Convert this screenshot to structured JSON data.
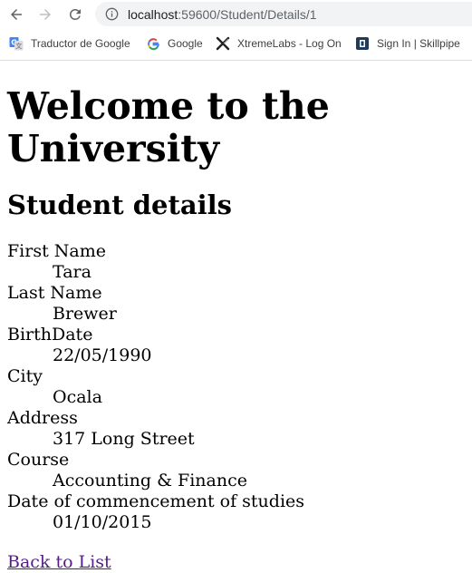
{
  "browser": {
    "url_host": "localhost",
    "url_path": ":59600/Student/Details/1",
    "bookmarks": [
      {
        "label": "Traductor de Google",
        "icon": "google-translate-icon"
      },
      {
        "label": "Google",
        "icon": "google-icon"
      },
      {
        "label": "XtremeLabs - Log On",
        "icon": "xtremelabs-icon"
      },
      {
        "label": "Sign In | Skillpipe",
        "icon": "skillpipe-icon"
      }
    ]
  },
  "page": {
    "title": "Welcome to the University",
    "subtitle": "Student details",
    "fields": [
      {
        "label": "First Name",
        "value": "Tara"
      },
      {
        "label": "Last Name",
        "value": "Brewer"
      },
      {
        "label": "BirthDate",
        "value": "22/05/1990"
      },
      {
        "label": "City",
        "value": "Ocala"
      },
      {
        "label": "Address",
        "value": "317 Long Street"
      },
      {
        "label": "Course",
        "value": "Accounting & Finance"
      },
      {
        "label": "Date of commencement of studies",
        "value": "01/10/2015"
      }
    ],
    "back_link": "Back to List"
  },
  "colors": {
    "visited_link": "#551a8b",
    "omnibox_bg": "#f1f3f4"
  }
}
